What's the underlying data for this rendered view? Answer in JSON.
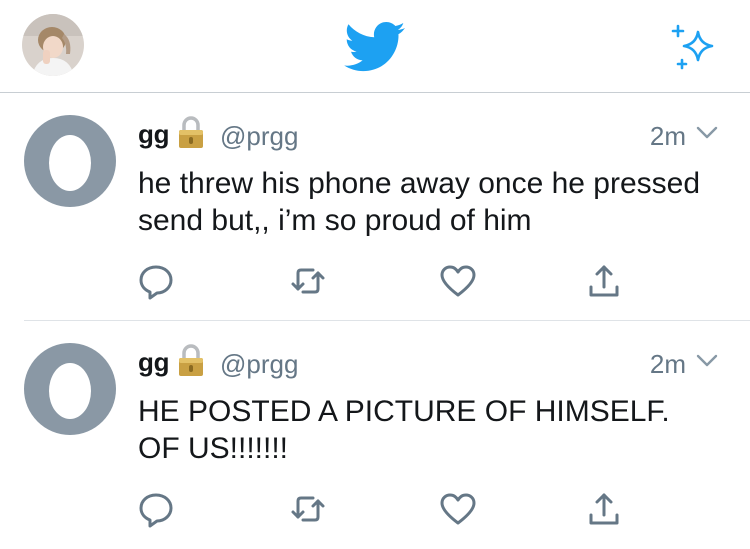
{
  "header": {
    "profile_avatar": "profile-photo",
    "logo_icon": "twitter-bird-icon",
    "action_icon": "sparkle-icon"
  },
  "tweets": [
    {
      "name": "gg",
      "protected_icon": "lock-icon",
      "handle": "@prgg",
      "time": "2m",
      "text": "he threw his phone away once he pressed send but,, i’m so proud of him"
    },
    {
      "name": "gg",
      "protected_icon": "lock-icon",
      "handle": "@prgg",
      "time": "2m",
      "text": "HE POSTED A PICTURE OF HIMSELF. OF US!!!!!!!"
    }
  ],
  "colors": {
    "brand_blue": "#1da1f2",
    "icon_gray": "#657786",
    "egg_gray": "#8a98a5",
    "divider": "#dfe3e7"
  }
}
